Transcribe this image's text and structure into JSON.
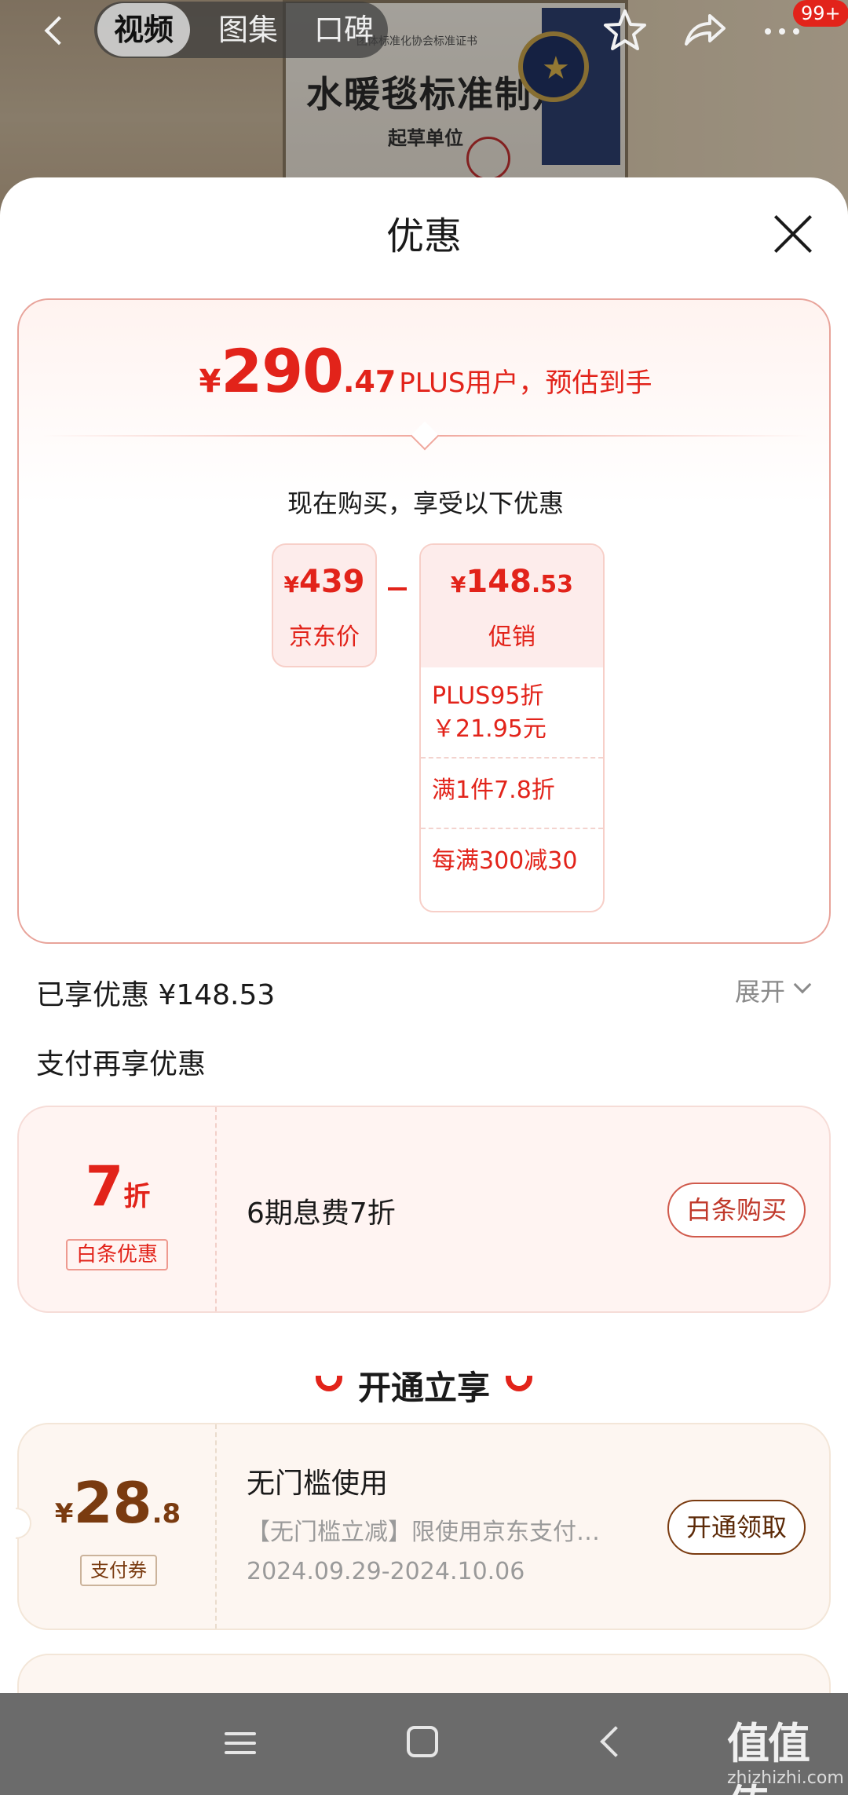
{
  "header": {
    "tabs": [
      {
        "label": "视频",
        "active": true
      },
      {
        "label": "图集",
        "active": false
      },
      {
        "label": "口碑",
        "active": false
      }
    ],
    "icons": [
      "back-icon",
      "star-icon",
      "share-icon",
      "more-icon"
    ],
    "badge": "99+"
  },
  "background_image": {
    "certificate_title": "水暖毯标准制定者",
    "certificate_subtitle": "起草单位",
    "certificate_header": "团体标准化协会标准证书"
  },
  "sheet": {
    "title": "优惠",
    "estimate": {
      "yen": "¥",
      "integer": "290",
      "decimal": ".47",
      "text": "PLUS用户，预估到手"
    },
    "buy_now_text": "现在购买，享受以下优惠",
    "jd_price": {
      "yen": "¥",
      "value": "439",
      "label": "京东价"
    },
    "promo": {
      "yen": "¥",
      "integer": "148",
      "decimal": ".53",
      "label": "促销",
      "items": [
        {
          "line1": "PLUS95折",
          "line2": "￥21.95元"
        },
        {
          "line1": "满1件7.8折"
        },
        {
          "line1": "每满300减30"
        }
      ]
    },
    "saved": "已享优惠 ¥148.53",
    "expand": "展开",
    "pay_more": "支付再享优惠",
    "baitiao": {
      "num": "7",
      "unit": "折",
      "tag": "白条优惠",
      "desc": "6期息费7折",
      "button": "白条购买"
    },
    "open_section": "开通立享",
    "coupon": {
      "yen": "¥",
      "integer": "28",
      "decimal": ".8",
      "tag": "支付券",
      "title": "无门槛使用",
      "desc": "【无门槛立减】限使用京东支付…",
      "date": "2024.09.29-2024.10.06",
      "button": "开通领取"
    }
  },
  "system_nav": {
    "icons": [
      "menu-icon",
      "home-icon",
      "back-icon"
    ],
    "watermark": "值值值",
    "watermark_sub": "zhizhizhi.com"
  },
  "colors": {
    "accent_red": "#e2231a",
    "coupon_brown": "#7a3b10",
    "nav_gray": "#6b6b6b"
  }
}
